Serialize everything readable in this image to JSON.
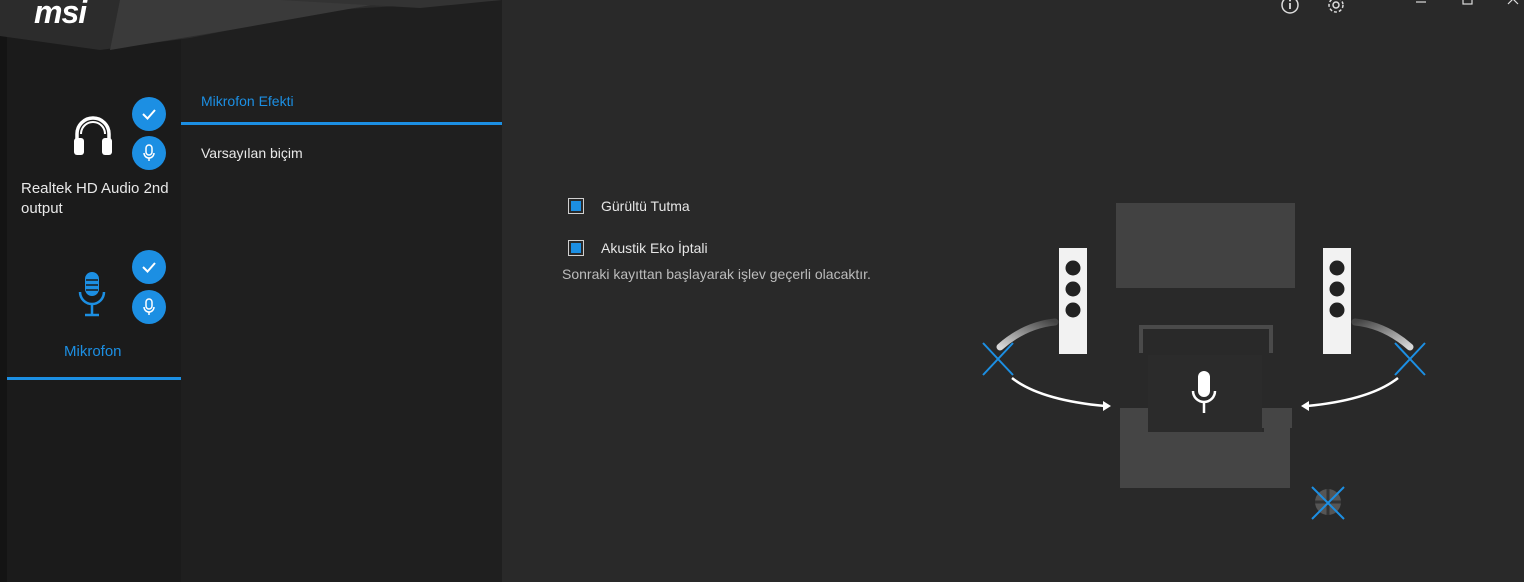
{
  "app": {
    "logo_text": "msi",
    "accent_color": "#1c8fe3"
  },
  "titlebar": {
    "info_icon": "info-icon",
    "settings_icon": "gear-icon",
    "minimize_icon": "minimize-icon",
    "maximize_icon": "maximize-icon",
    "close_icon": "close-icon"
  },
  "devices": [
    {
      "name": "Realtek HD Audio 2nd output",
      "icon": "headphones-icon",
      "badges": [
        "check-icon",
        "microphone-icon"
      ],
      "active": false
    },
    {
      "name": "Mikrofon",
      "icon": "microphone-icon",
      "badges": [
        "check-icon",
        "microphone-icon"
      ],
      "active": true
    }
  ],
  "menu": {
    "items": [
      {
        "label": "Mikrofon Efekti",
        "active": true
      },
      {
        "label": "Varsayılan biçim",
        "active": false
      }
    ]
  },
  "effects": {
    "options": [
      {
        "label": "Gürültü Tutma",
        "checked": true
      },
      {
        "label": "Akustik Eko İptali",
        "checked": true
      }
    ],
    "note": "Sonraki kayıttan başlayarak işlev geçerli olacaktır."
  },
  "illustration": {
    "name": "acoustic-echo-cancellation-diagram"
  }
}
